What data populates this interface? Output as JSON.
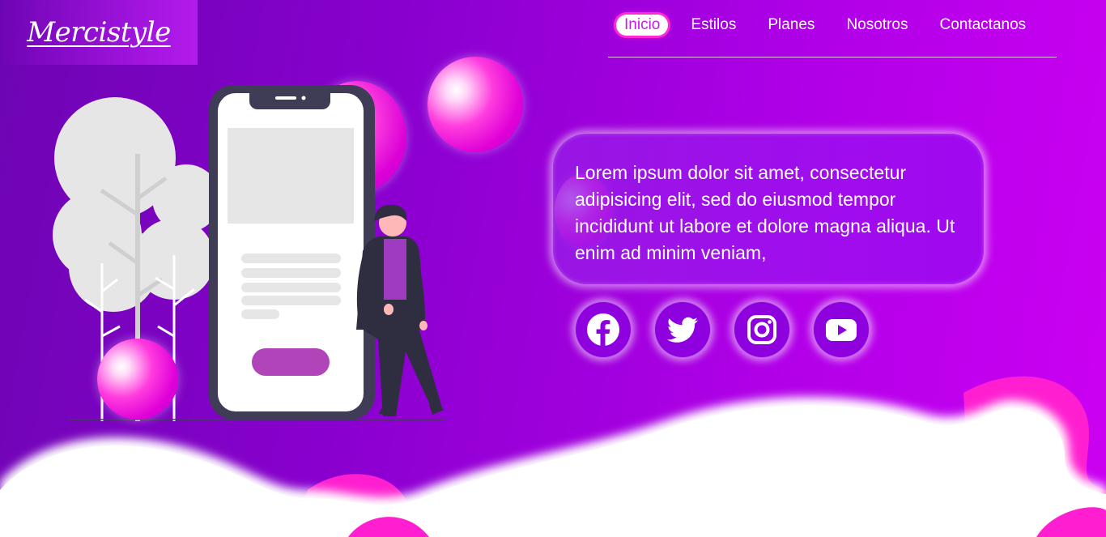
{
  "brand": {
    "logo_text": "Mercistyle"
  },
  "nav": {
    "items": [
      {
        "label": "Inicio",
        "active": true
      },
      {
        "label": "Estilos",
        "active": false
      },
      {
        "label": "Planes",
        "active": false
      },
      {
        "label": "Nosotros",
        "active": false
      },
      {
        "label": "Contactanos",
        "active": false
      }
    ]
  },
  "hero": {
    "paragraph": "Lorem ipsum dolor sit amet, consectetur adipisicing elit, sed do eiusmod tempor incididunt ut labore et dolore magna aliqua. Ut enim ad minim veniam,"
  },
  "social": {
    "icons": [
      "facebook-icon",
      "twitter-icon",
      "instagram-icon",
      "youtube-icon"
    ]
  },
  "colors": {
    "accent_pink": "#ff2ad6",
    "bg_purple": "#8a00cf",
    "active_text": "#c21fe0"
  }
}
